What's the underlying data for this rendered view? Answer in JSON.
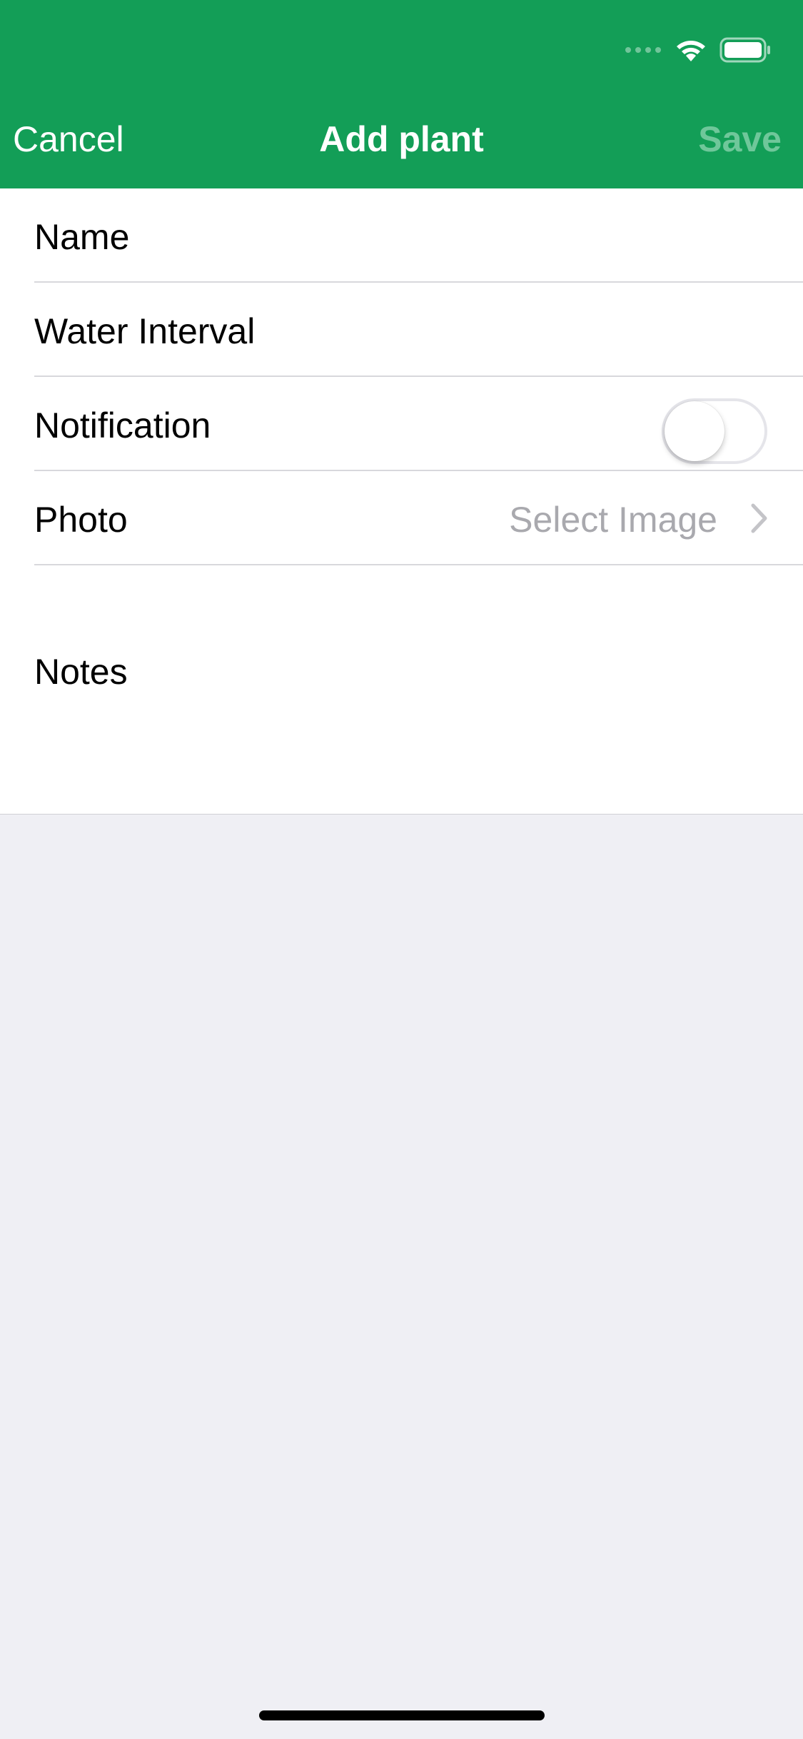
{
  "nav": {
    "cancel": "Cancel",
    "title": "Add plant",
    "save": "Save"
  },
  "form": {
    "rows": [
      {
        "label": "Name"
      },
      {
        "label": "Water Interval"
      },
      {
        "label": "Notification",
        "toggle_on": false
      },
      {
        "label": "Photo",
        "value": "Select Image"
      }
    ],
    "notes_label": "Notes"
  },
  "icons": {
    "signal": "cellular-signal-icon",
    "wifi": "wifi-icon",
    "battery": "battery-icon",
    "chevron": "chevron-right-icon"
  },
  "colors": {
    "header_bg": "#139e57",
    "save_disabled": "#6fc79a",
    "background": "#efeff4",
    "placeholder": "#a9a9ae"
  }
}
